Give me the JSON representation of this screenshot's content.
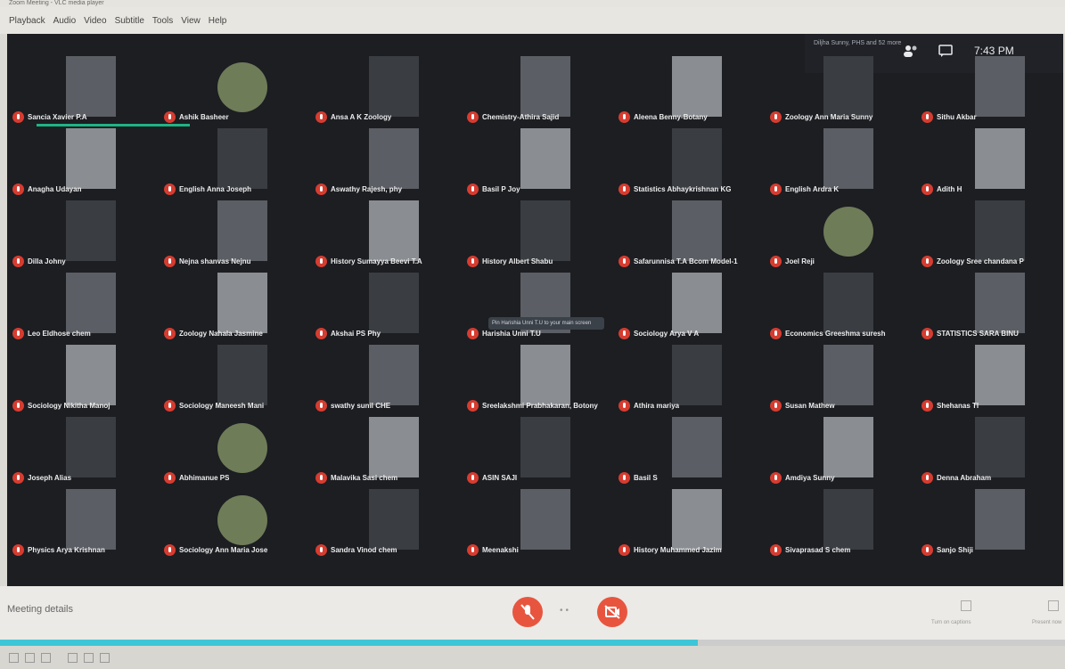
{
  "window_title": "Zoom Meeting - VLC media player",
  "menu": [
    "Playback",
    "Audio",
    "Video",
    "Subtitle",
    "Tools",
    "View",
    "Help"
  ],
  "header": {
    "notice": "Diljha Sunny, PHS and 52 more",
    "clock": "7:43 PM"
  },
  "self_tile": {
    "name": "Sancia Xavier P.A"
  },
  "hover_tooltip": "Pin Harishia Unni T.U to your main screen",
  "bottom": {
    "meeting_details": "Meeting details",
    "captions_label": "Turn on captions",
    "present_label": "Present now"
  },
  "playback_progress": 0.655,
  "participants": [
    "Sancia Xavier P.A",
    "Ashik Basheer",
    "Ansa A K Zoology",
    "Chemistry-Athira Sajid",
    "Aleena Benny-Botany",
    "Zoology Ann Maria Sunny",
    "Sithu Akbar",
    "Anagha Udayan",
    "English Anna Joseph",
    "Aswathy Rajesh, phy",
    "Basil P Joy",
    "Statistics Abhaykrishnan KG",
    "English Ardra K",
    "Adith H",
    "Dilla Johny",
    "Nejna shanvas Nejnu",
    "History Sumayya Beevi T.A",
    "History Albert Shabu",
    "Safarunnisa T.A Bcom Model-1",
    "Joel Reji",
    "Zoology Sree chandana P",
    "Leo Eldhose chem",
    "Zoology Nahala Jasmine",
    "Akshai PS Phy",
    "Harishia Unni T.U",
    "Sociology Arya V A",
    "Economics Greeshma suresh",
    "STATISTICS SARA BINU",
    "Sociology Nikitha Manoj",
    "Sociology Maneesh Mani",
    "swathy sunil CHE",
    "Sreelakshmi Prabhakaran, Botony",
    "Athira mariya",
    "Susan Mathew",
    "Shehanas TI",
    "Joseph Alias",
    "Abhimanue PS",
    "Malavika Sasi chem",
    "ASIN SAJI",
    "Basil S",
    "Amdiya Sunny",
    "Denna Abraham",
    "Physics Arya Krishnan",
    "Sociology Ann Maria Jose",
    "Sandra Vinod chem",
    "Meenakshi",
    "History Muhammed Jazim",
    "Sivaprasad S chem",
    "Sanjo Shiji"
  ]
}
